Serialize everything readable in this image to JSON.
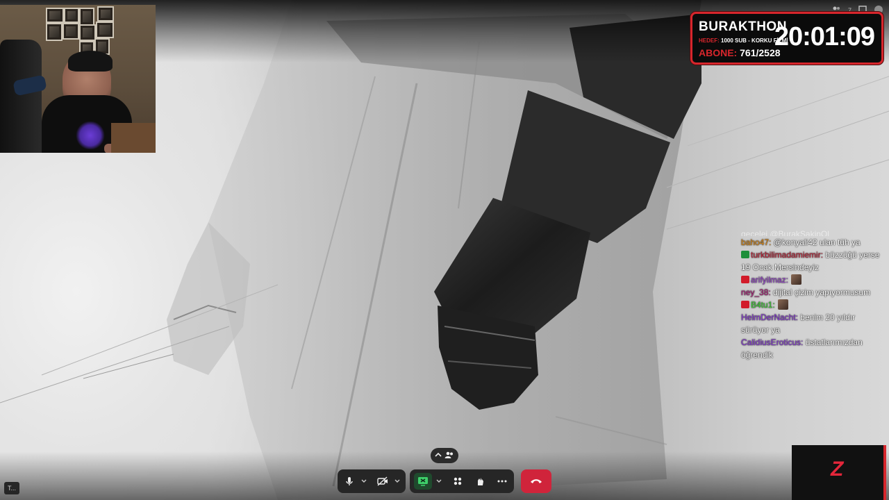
{
  "counter": {
    "title": "BURAKTHON",
    "goal_key": "HEDEF:",
    "goal_value": "1000 SUB - KORKU FİLMİ",
    "sub_key": "ABONE:",
    "sub_value": "761/2528",
    "timer": "20:01:09"
  },
  "top_right": {
    "viewers": "7"
  },
  "chat": {
    "clipped_line": "gecelei @BurakSakinOl",
    "messages": [
      {
        "user": "baho47:",
        "user_color": "#d98a1c",
        "badge": "",
        "text": "@konyali42 ulan tüh ya",
        "emote": false
      },
      {
        "user": "turkbilimadamiemir:",
        "user_color": "#c22a3e",
        "badge": "#1e8f3a",
        "text": "büzzüğü yerse 19 Ocak Mersindeyiz",
        "emote": false
      },
      {
        "user": "arifyilmaz:",
        "user_color": "#9b4ad1",
        "badge": "#d21c2a",
        "text": "",
        "emote": true
      },
      {
        "user": "ney_38:",
        "user_color": "#b0257e",
        "badge": "",
        "text": "dijital çizim yapıyormusum",
        "emote": false
      },
      {
        "user": "B4tu1:",
        "user_color": "#42d13a",
        "badge": "#d21c2a",
        "text": "",
        "emote": true
      },
      {
        "user": "HelmDerNacht:",
        "user_color": "#8a3fd6",
        "badge": "",
        "text": "benim 20 yıldır sürüyor ya",
        "emote": false
      },
      {
        "user": "CalidiusEroticus:",
        "user_color": "#8a3fd6",
        "badge": "",
        "text": "üstatlarımızdan öğrendik",
        "emote": false
      }
    ]
  },
  "toolbar": {
    "corner_label": "T..."
  },
  "colors": {
    "accent_red": "#d7262c",
    "end_call": "#d0243b",
    "share_active": "#1f4a2d"
  },
  "icons": [
    "microphone-icon",
    "camera-off-icon",
    "share-screen-icon",
    "apps-icon",
    "reactions-icon",
    "more-icon",
    "end-call-icon",
    "people-icon",
    "chevron-up-icon"
  ]
}
